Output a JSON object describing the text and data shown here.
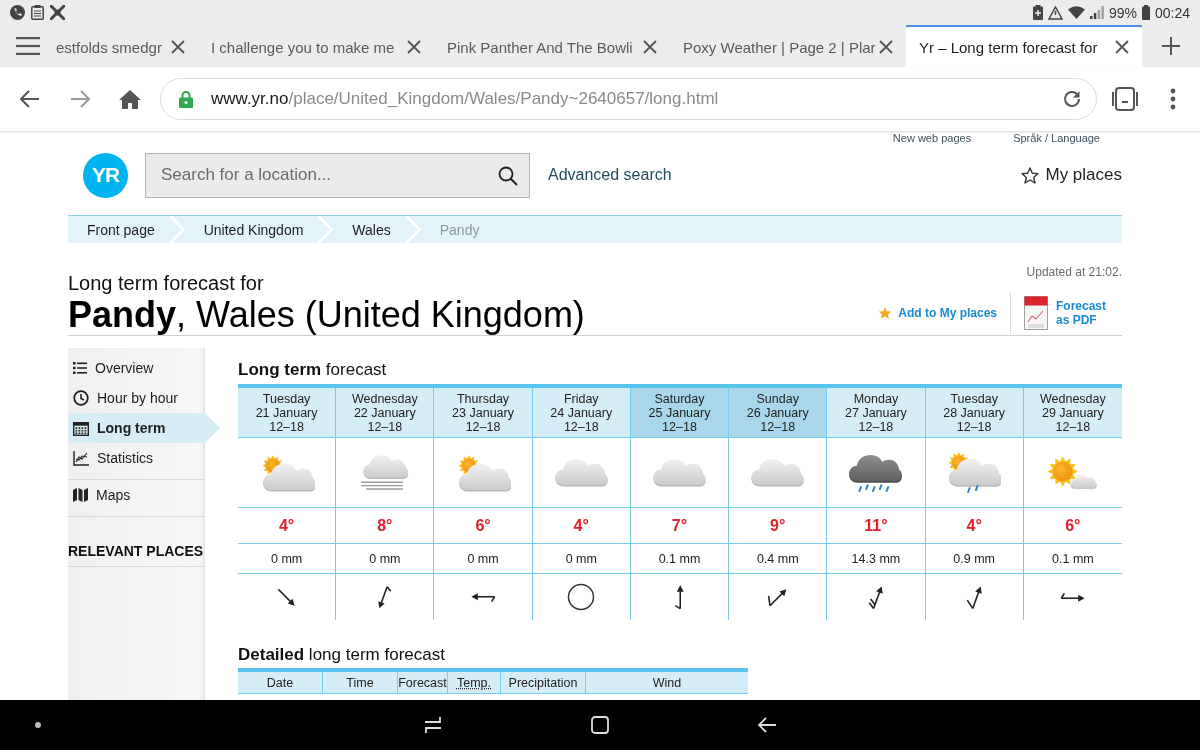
{
  "status_bar": {
    "battery": "99%",
    "time": "00:24"
  },
  "tabs": [
    {
      "title": "estfolds smedgr",
      "selected": false
    },
    {
      "title": "I challenge you to make me",
      "selected": false
    },
    {
      "title": "Pink Panther And The Bowli",
      "selected": false
    },
    {
      "title": "Poxy Weather | Page 2 | Plar",
      "selected": false
    },
    {
      "title": "Yr – Long term forecast for",
      "selected": true
    }
  ],
  "address": {
    "host": "www.yr.no",
    "path": "/place/United_Kingdom/Wales/Pandy~2640657/long.html"
  },
  "top_links": [
    "New web pages",
    "Språk / Language"
  ],
  "header": {
    "logo": "YR",
    "search": {
      "placeholder": "Search for a location..."
    },
    "advanced_search": "Advanced search",
    "my_places": "My places"
  },
  "breadcrumb": [
    {
      "label": "Front page",
      "current": false
    },
    {
      "label": "United Kingdom",
      "current": false
    },
    {
      "label": "Wales",
      "current": false
    },
    {
      "label": "Pandy",
      "current": true
    }
  ],
  "title_block": {
    "subtitle": "Long term forecast for",
    "title": "**Pandy**, Wales (United Kingdom)",
    "updated": "Updated at 21:02.",
    "add_to_places": "Add to My places",
    "pdf": "Forecast as PDF"
  },
  "sidebar": {
    "sections": [
      {
        "items": [
          {
            "label": "Overview",
            "selected": false
          },
          {
            "label": "Hour by hour",
            "selected": false
          },
          {
            "label": "Long term",
            "selected": true
          },
          {
            "label": "Statistics",
            "selected": false
          }
        ]
      },
      {
        "items": [
          {
            "label": "Maps",
            "selected": false
          }
        ]
      }
    ],
    "heading": "RELEVANT PLACES"
  },
  "forecast": {
    "title": "**Long term** forecast",
    "days": [
      {
        "weekday": "Tuesday",
        "date": "21 January",
        "hours": "12–18",
        "weekend": false,
        "symbol": {
          "kind": "partly-cloudy"
        },
        "temperature": "4°",
        "precipitation": "0 mm",
        "wind": {
          "kind": "se"
        }
      },
      {
        "weekday": "Wednesday",
        "date": "22 January",
        "hours": "12–18",
        "weekend": false,
        "symbol": {
          "kind": "fog"
        },
        "temperature": "8°",
        "precipitation": "0 mm",
        "wind": {
          "kind": "ssw-short"
        }
      },
      {
        "weekday": "Thursday",
        "date": "23 January",
        "hours": "12–18",
        "weekend": false,
        "symbol": {
          "kind": "partly-cloudy"
        },
        "temperature": "6°",
        "precipitation": "0 mm",
        "wind": {
          "kind": "w-short"
        }
      },
      {
        "weekday": "Friday",
        "date": "24 January",
        "hours": "12–18",
        "weekend": false,
        "symbol": {
          "kind": "cloudy"
        },
        "temperature": "4°",
        "precipitation": "0 mm",
        "wind": {
          "kind": "calm"
        }
      },
      {
        "weekday": "Saturday",
        "date": "25 January",
        "hours": "12–18",
        "weekend": true,
        "symbol": {
          "kind": "cloudy"
        },
        "temperature": "7°",
        "precipitation": "0.1 mm",
        "wind": {
          "kind": "n-short"
        }
      },
      {
        "weekday": "Sunday",
        "date": "26 January",
        "hours": "12–18",
        "weekend": true,
        "symbol": {
          "kind": "cloudy"
        },
        "temperature": "9°",
        "precipitation": "0.4 mm",
        "wind": {
          "kind": "ne-long"
        }
      },
      {
        "weekday": "Monday",
        "date": "27 January",
        "hours": "12–18",
        "weekend": false,
        "symbol": {
          "kind": "heavy-rain"
        },
        "temperature": "11°",
        "precipitation": "14.3 mm",
        "wind": {
          "kind": "nne-double"
        }
      },
      {
        "weekday": "Tuesday",
        "date": "28 January",
        "hours": "12–18",
        "weekend": false,
        "symbol": {
          "kind": "partly-cloudy-rain"
        },
        "temperature": "4°",
        "precipitation": "0.9 mm",
        "wind": {
          "kind": "nne-long"
        }
      },
      {
        "weekday": "Wednesday",
        "date": "29 January",
        "hours": "12–18",
        "weekend": false,
        "symbol": {
          "kind": "fair"
        },
        "temperature": "6°",
        "precipitation": "0.1 mm",
        "wind": {
          "kind": "e-short"
        }
      }
    ]
  },
  "detailed": {
    "title": "**Detailed** long term forecast",
    "columns": [
      {
        "label": "Date",
        "abbreviation": false
      },
      {
        "label": "Time",
        "abbreviation": false
      },
      {
        "label": "Forecast",
        "abbreviation": false
      },
      {
        "label": "Temp.",
        "abbreviation": true
      },
      {
        "label": "Precipitation",
        "abbreviation": false
      },
      {
        "label": "Wind",
        "abbreviation": false
      }
    ]
  }
}
